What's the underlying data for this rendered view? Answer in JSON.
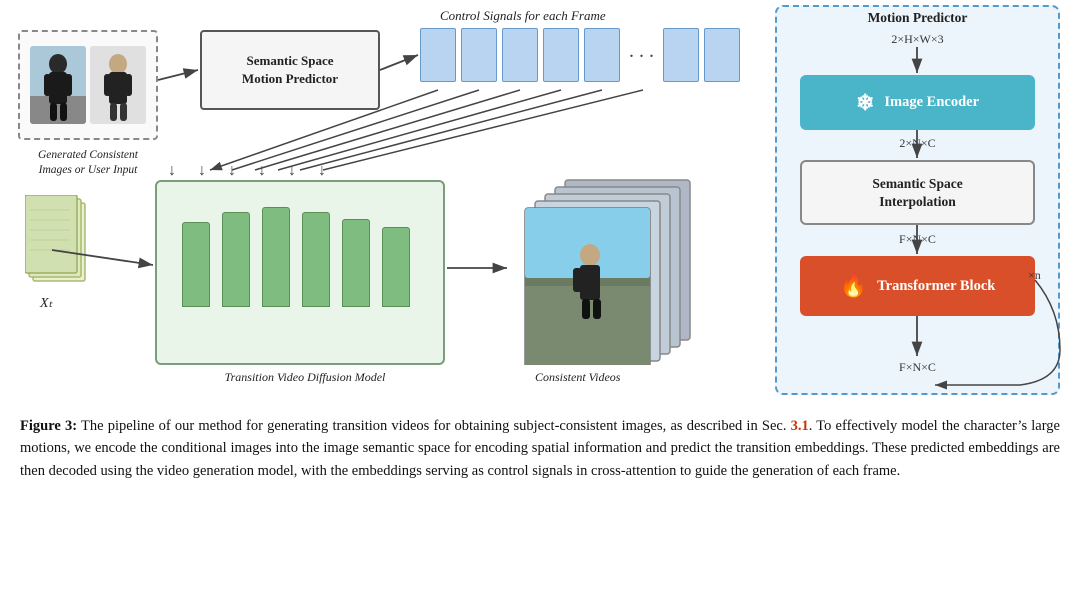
{
  "diagram": {
    "control_signals_label": "Control Signals for each Frame",
    "left_images_label": "Generated Consistent\nImages or User Input",
    "ssmp_label": "Semantic Space\nMotion Predictor",
    "xt_label": "Xₜ",
    "tvdm_label": "Transition Video Diffusion Model",
    "consistent_videos_label": "Consistent Videos",
    "mp_title": "Motion Predictor",
    "mp_dim_top": "2×H×W×3",
    "mp_image_encoder_label": "Image Encoder",
    "mp_dim_mid1": "2×N×C",
    "mp_ssi_label": "Semantic Space\nInterpolation",
    "mp_dim_mid2": "F×N×C",
    "mp_transformer_label": "Transformer Block",
    "mp_xn": "×n",
    "mp_dim_bottom": "F×N×C"
  },
  "caption": {
    "figure_num": "Figure 3:",
    "text": "  The pipeline of our method for generating transition videos for obtaining subject-consistent images, as described in Sec. ",
    "sec_ref": "3.1",
    "text2": ".  To effectively model the character’s large motions, we encode the conditional images into the image semantic space for encoding spatial information and predict the transition embeddings.  These predicted embeddings are then decoded using the video generation model, with the embeddings serving as control signals in cross-attention to guide the generation of each frame."
  }
}
